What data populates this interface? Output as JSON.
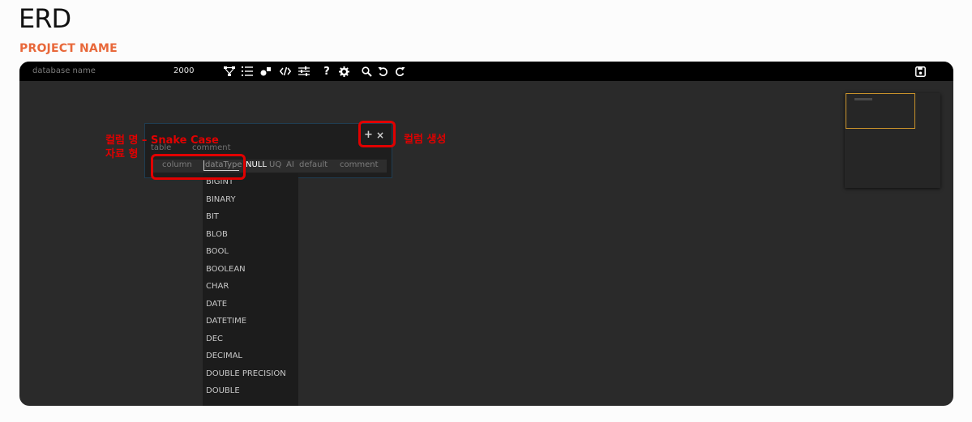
{
  "page": {
    "title": "ERD",
    "subtitle": "PROJECT NAME"
  },
  "toolbar": {
    "database_name_placeholder": "database name",
    "database_size": "2000",
    "icons": [
      "relationship-icon",
      "list-icon",
      "shapes-icon",
      "code-icon",
      "sliders-icon",
      "help-icon",
      "gear-icon",
      "search-icon",
      "undo-icon",
      "redo-icon",
      "save-icon"
    ]
  },
  "table_card": {
    "name_placeholder": "table",
    "comment_placeholder": "comment",
    "add_label": "+",
    "close_label": "×",
    "column": {
      "name_placeholder": "column",
      "type_placeholder": "dataType",
      "null_label": "NULL",
      "unique_label": "UQ",
      "auto_increment_label": "AI",
      "default_placeholder": "default",
      "comment_placeholder": "comment"
    }
  },
  "datatype_options": [
    "BIGINT",
    "BINARY",
    "BIT",
    "BLOB",
    "BOOL",
    "BOOLEAN",
    "CHAR",
    "DATE",
    "DATETIME",
    "DEC",
    "DECIMAL",
    "DOUBLE PRECISION",
    "DOUBLE"
  ],
  "annotations": {
    "column_line1": "컬럼 명 – Snake Case",
    "column_line2": "자료 형",
    "add_column": "컬럼 생성"
  },
  "colors": {
    "accent": "#e8683a",
    "annotation": "#e10000",
    "minimap_viewport": "#c9922b",
    "canvas": "#2a2a2a",
    "toolbar": "#000000"
  }
}
